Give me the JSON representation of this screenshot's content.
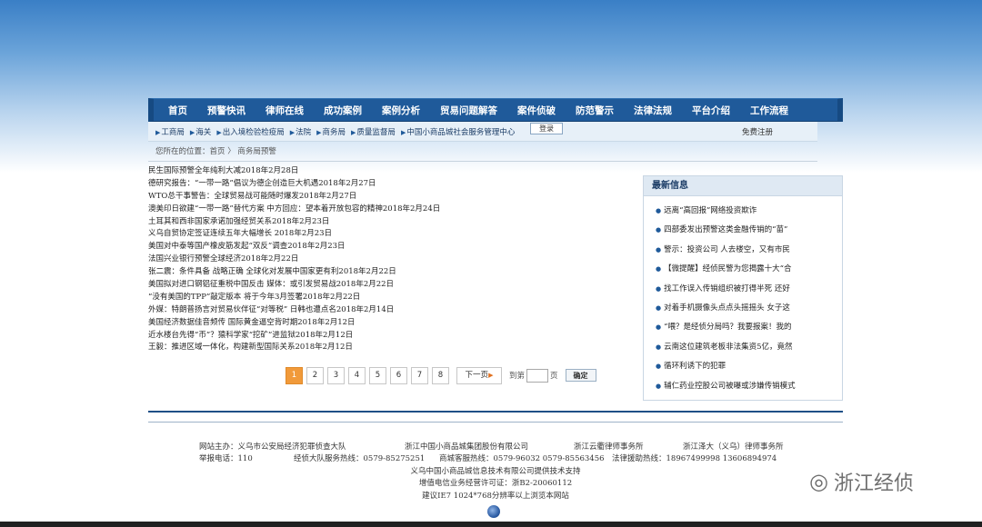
{
  "nav": {
    "items": [
      "首页",
      "预警快讯",
      "律师在线",
      "成功案例",
      "案例分析",
      "贸易问题解答",
      "案件侦破",
      "防范警示",
      "法律法规",
      "平台介绍",
      "工作流程"
    ]
  },
  "subnav": {
    "items": [
      "工商局",
      "海关",
      "出入境检验检疫局",
      "法院",
      "商务局",
      "质量监督局",
      "中国小商品城社会服务管理中心"
    ],
    "login_label": "登录",
    "register_label": "免费注册"
  },
  "breadcrumb": {
    "text": "您所在的位置：首页 〉 商务局预警"
  },
  "news": [
    "民生国际预警全年纯利大减2018年2月28日",
    "德研究报告：“一带一路”倡议为德企创造巨大机遇2018年2月27日",
    "WTO总干事警告：全球贸易战可能随时爆发2018年2月27日",
    "澳美印日欲建“一带一路”替代方案  中方回应：望本着开放包容的精神2018年2月24日",
    "土耳其和西非国家承诺加强经贸关系2018年2月23日",
    "义乌自贸协定签证连续五年大幅增长 2018年2月23日",
    "美国对中泰等国产橡皮筋发起“双反”调查2018年2月23日",
    "法国兴业银行预警全球经济2018年2月22日",
    "张二震：条件具备 战略正确 全球化对发展中国家更有利2018年2月22日",
    "美国拟对进口钢铝征重税中国反击 媒体：或引发贸易战2018年2月22日",
    "“没有美国的TPP”敲定版本 将于今年3月签署2018年2月22日",
    "外媒：特朗普扬言对贸易伙伴征“对等税” 日韩也遭点名2018年2月14日",
    "美国经济数据佳音频传 国际黄金逼空背时期2018年2月12日",
    "近水楼台先得“币”？猿科学家“挖矿”进监狱2018年2月12日",
    "王毅：推进区域一体化，构建新型国际关系2018年2月12日"
  ],
  "pager": {
    "pages": [
      "1",
      "2",
      "3",
      "4",
      "5",
      "6",
      "7",
      "8"
    ],
    "current": "1",
    "next_label": "下一页",
    "goto_prefix": "到第",
    "goto_suffix": "页",
    "confirm_label": "确定"
  },
  "sidebar": {
    "title": "最新信息",
    "items": [
      "远离“高回报”网络投资欺诈",
      "四部委发出预警这类金融传销的“苗”",
      "警示：投资公司 人去楼空，又有市民",
      "【微提醒】经侦民警为您揭露十大“合",
      "找工作误入传销组织被打得半死 还好",
      "对着手机摄像头点点头摇摇头 女子这",
      "“喂？是经侦分局吗？我要报案！我的",
      "云南这位建筑老板非法集资5亿，竟然",
      "循环利诱下的犯罪",
      "辅仁药业控股公司被曝或涉嫌传销模式"
    ]
  },
  "footer": {
    "sponsor_label": "网站主办：义乌市公安局经济犯罪侦查大队",
    "org1": "浙江中国小商品城集团股份有限公司",
    "org2": "浙江云衢律师事务所",
    "org3": "浙江泽大（义乌）律师事务所",
    "report_phone": "举报电话：110",
    "econ_phone": "经侦大队服务热线：0579-85275251",
    "mall_phone": "商城客服热线：0579-96032  0579-85563456",
    "legal_phone": "法律援助热线：18967499998  13606894974",
    "tech_support": "义乌中国小商品城信息技术有限公司提供技术支持",
    "license": "增值电信业务经营许可证：浙B2-20060112",
    "browser_note": "建议IE7 1024*768分辨率以上浏览本网站"
  },
  "watermark": {
    "text": "浙江经侦"
  }
}
